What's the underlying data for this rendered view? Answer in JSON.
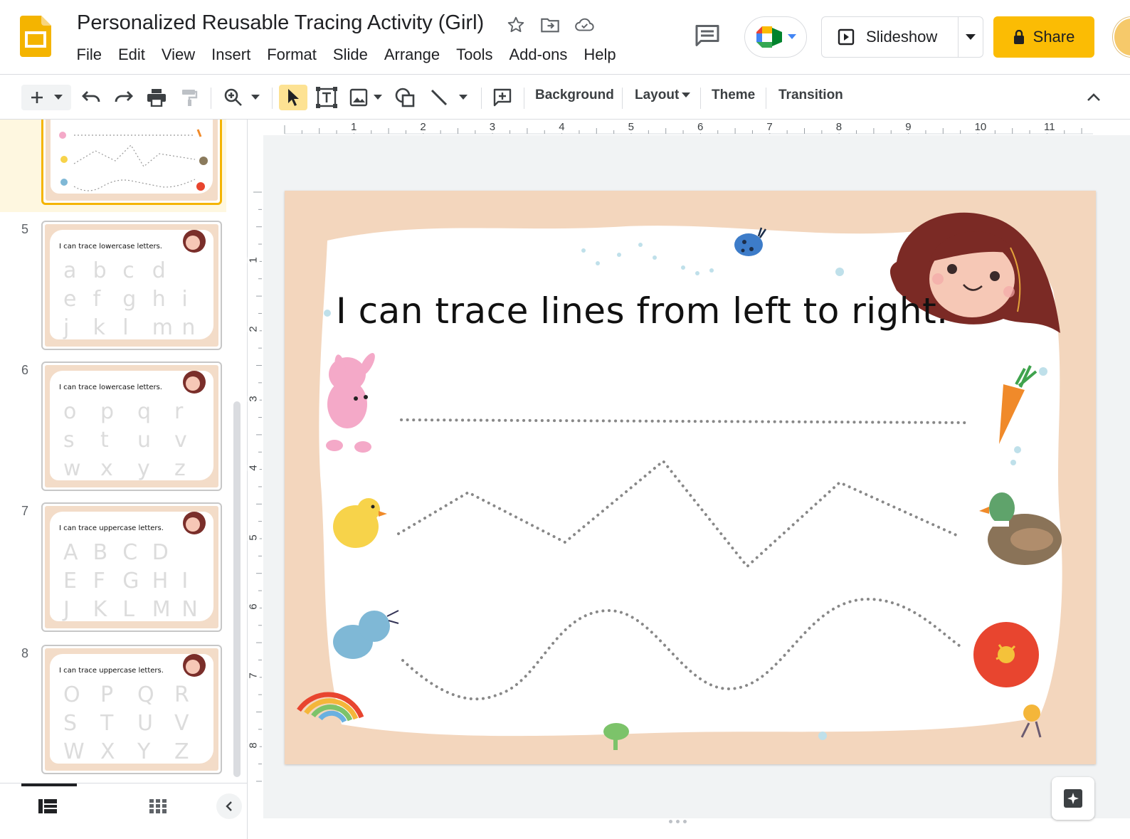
{
  "doc": {
    "title": "Personalized Reusable Tracing Activity (Girl)"
  },
  "menu": [
    "File",
    "Edit",
    "View",
    "Insert",
    "Format",
    "Slide",
    "Arrange",
    "Tools",
    "Add-ons",
    "Help"
  ],
  "header": {
    "slideshow_label": "Slideshow",
    "share_label": "Share"
  },
  "toolbar": {
    "background_label": "Background",
    "layout_label": "Layout",
    "theme_label": "Theme",
    "transition_label": "Transition"
  },
  "ruler": {
    "h": [
      "1",
      "2",
      "3",
      "4",
      "5",
      "6",
      "7",
      "8",
      "9",
      "10",
      "11"
    ],
    "v": [
      "1",
      "2",
      "3",
      "4",
      "5",
      "6",
      "7",
      "8"
    ]
  },
  "filmstrip": {
    "slides": [
      {
        "number": "5",
        "title": "I can trace lowercase letters.",
        "letters": [
          "a",
          "b",
          "c",
          "d",
          "e",
          "f",
          "g",
          "h",
          "i",
          "j",
          "k",
          "l",
          "m",
          "n"
        ]
      },
      {
        "number": "6",
        "title": "I can trace lowercase letters.",
        "letters": [
          "o",
          "p",
          "q",
          "r",
          "s",
          "t",
          "u",
          "v",
          "w",
          "x",
          "y",
          "z"
        ]
      },
      {
        "number": "7",
        "title": "I can trace uppercase letters.",
        "letters": [
          "A",
          "B",
          "C",
          "D",
          "E",
          "F",
          "G",
          "H",
          "I",
          "J",
          "K",
          "L",
          "M",
          "N"
        ]
      },
      {
        "number": "8",
        "title": "I can trace uppercase letters.",
        "letters": [
          "O",
          "P",
          "Q",
          "R",
          "S",
          "T",
          "U",
          "V",
          "W",
          "X",
          "Y",
          "Z"
        ]
      }
    ]
  },
  "slide": {
    "title": "I can trace lines from left to right."
  },
  "colors": {
    "accent": "#fbbc04",
    "selected_bg": "#fef7e0",
    "slide_border": "#f3d6bd"
  }
}
